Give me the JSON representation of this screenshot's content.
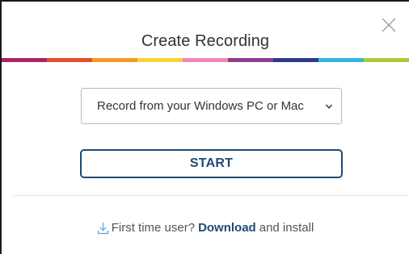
{
  "dialog": {
    "title": "Create Recording",
    "close_icon": "close-icon",
    "stripe_colors": [
      "#a6256b",
      "#e44e2e",
      "#f39c23",
      "#f6d33c",
      "#ef88b7",
      "#8b3f8d",
      "#2d3c89",
      "#35b5e5",
      "#b4c935"
    ]
  },
  "source_select": {
    "selected": "Record from your Windows PC or Mac",
    "icon": "chevron-down-icon"
  },
  "start_button": {
    "label": "START"
  },
  "footer": {
    "icon": "download-icon",
    "prefix": "First time user?",
    "link_label": "Download",
    "suffix": "and install"
  },
  "colors": {
    "accent": "#1e4b73",
    "text": "#333333",
    "border": "#b9b9b9"
  }
}
